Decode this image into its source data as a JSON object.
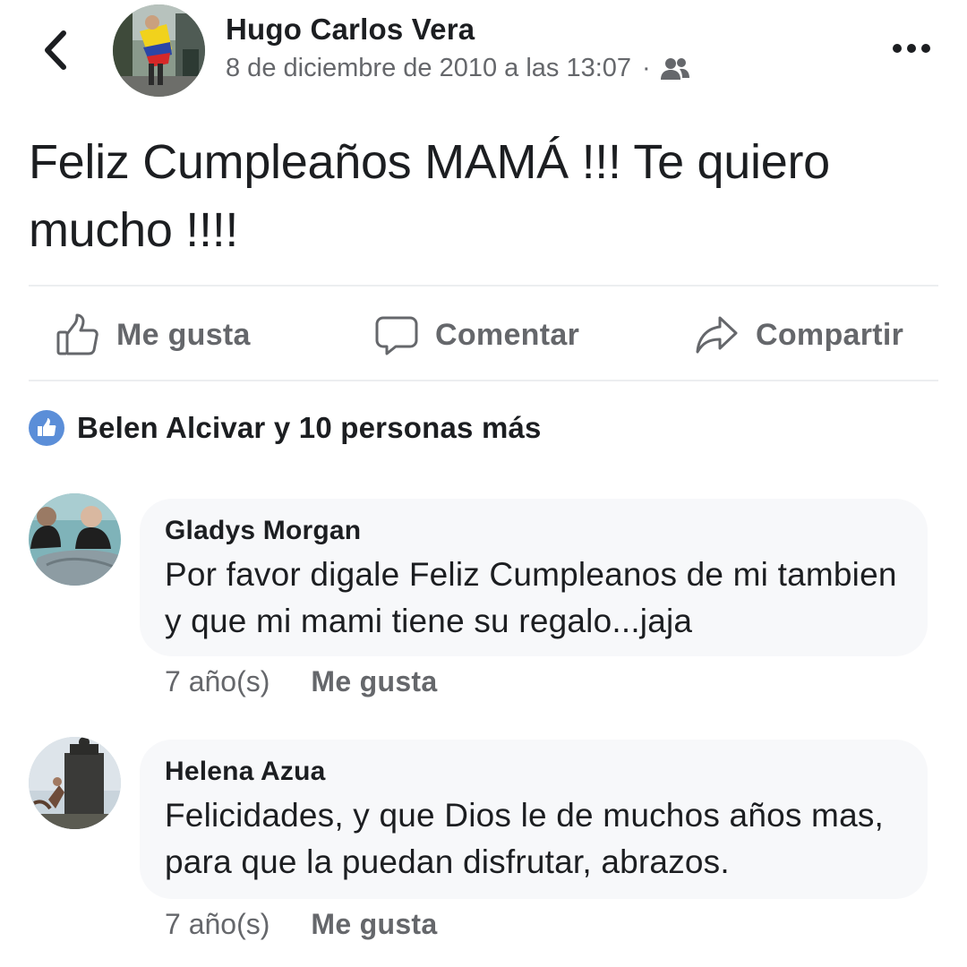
{
  "header": {
    "author": "Hugo Carlos Vera",
    "timestamp": "8 de diciembre de 2010 a las 13:07",
    "separator": "·",
    "audience_icon": "friends-icon",
    "back_icon": "chevron-left-icon",
    "more_icon": "more-horizontal-icon"
  },
  "post": {
    "text": "Feliz Cumpleaños MAMÁ !!! Te quiero mucho !!!!"
  },
  "actions": {
    "like_label": "Me gusta",
    "comment_label": "Comentar",
    "share_label": "Compartir"
  },
  "reactions": {
    "summary": "Belen Alcivar y 10 personas más"
  },
  "comments": [
    {
      "author": "Gladys Morgan",
      "text": "Por favor digale Feliz Cumpleanos de mi tambien y que mi mami tiene su regalo...jaja",
      "time": "7 año(s)",
      "like_label": "Me gusta"
    },
    {
      "author": "Helena Azua",
      "text": "Felicidades, y que Dios le de muchos años mas, para que la puedan disfrutar, abrazos.",
      "time": "7 año(s)",
      "like_label": "Me gusta"
    }
  ],
  "colors": {
    "text": "#1c1e21",
    "secondary": "#65676b",
    "bubble": "#f7f8fa",
    "like_badge": "#5b8ed8"
  }
}
